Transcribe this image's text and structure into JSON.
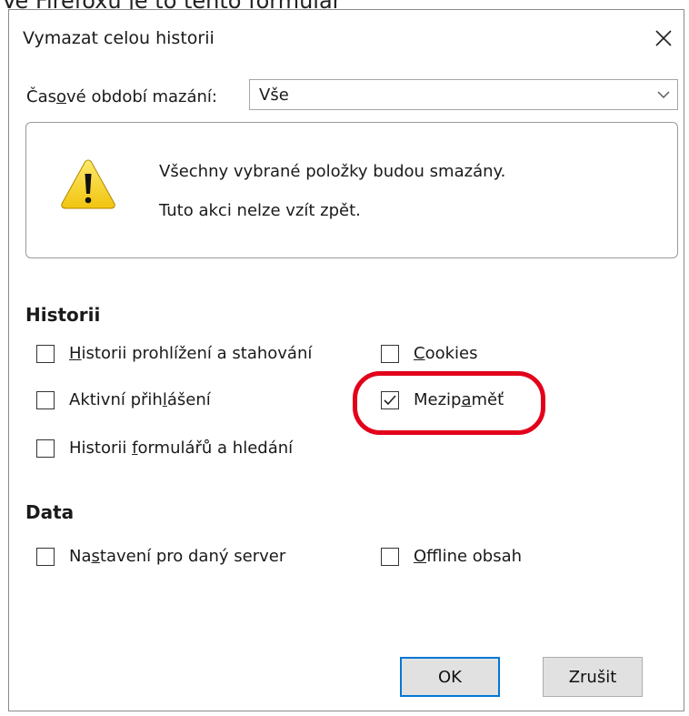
{
  "caption": "Ve Firefoxu je to tento formulář",
  "dialog": {
    "title": "Vymazat celou historii",
    "time_range": {
      "label_before": "Čas",
      "label_underline": "o",
      "label_after": "vé období mazání:",
      "selected": "Vše"
    },
    "warning": {
      "line1": "Všechny vybrané položky budou smazány.",
      "line2": "Tuto akci nelze vzít zpět."
    },
    "history": {
      "title": "Historii",
      "items": [
        {
          "id": "browsing",
          "pre": "",
          "u": "H",
          "post": "istorii prohlížení a stahování",
          "checked": false
        },
        {
          "id": "cookies",
          "pre": "",
          "u": "C",
          "post": "ookies",
          "checked": false
        },
        {
          "id": "logins",
          "pre": "Aktivní přih",
          "u": "l",
          "post": "ášení",
          "checked": false
        },
        {
          "id": "cache",
          "pre": "Mezip",
          "u": "a",
          "post": "měť",
          "checked": true
        },
        {
          "id": "forms",
          "pre": "Historii ",
          "u": "f",
          "post": "ormulářů a hledání",
          "checked": false
        }
      ]
    },
    "data": {
      "title": "Data",
      "items": [
        {
          "id": "siteprefs",
          "pre": "Na",
          "u": "s",
          "post": "tavení pro daný server",
          "checked": false
        },
        {
          "id": "offline",
          "pre": "",
          "u": "O",
          "post": "ffline obsah",
          "checked": false
        }
      ]
    },
    "buttons": {
      "ok": "OK",
      "cancel": "Zrušit"
    },
    "colors": {
      "highlight": "#e2001a",
      "warning_yellow": "#f7d21f",
      "default_button_border": "#0078d7"
    }
  }
}
